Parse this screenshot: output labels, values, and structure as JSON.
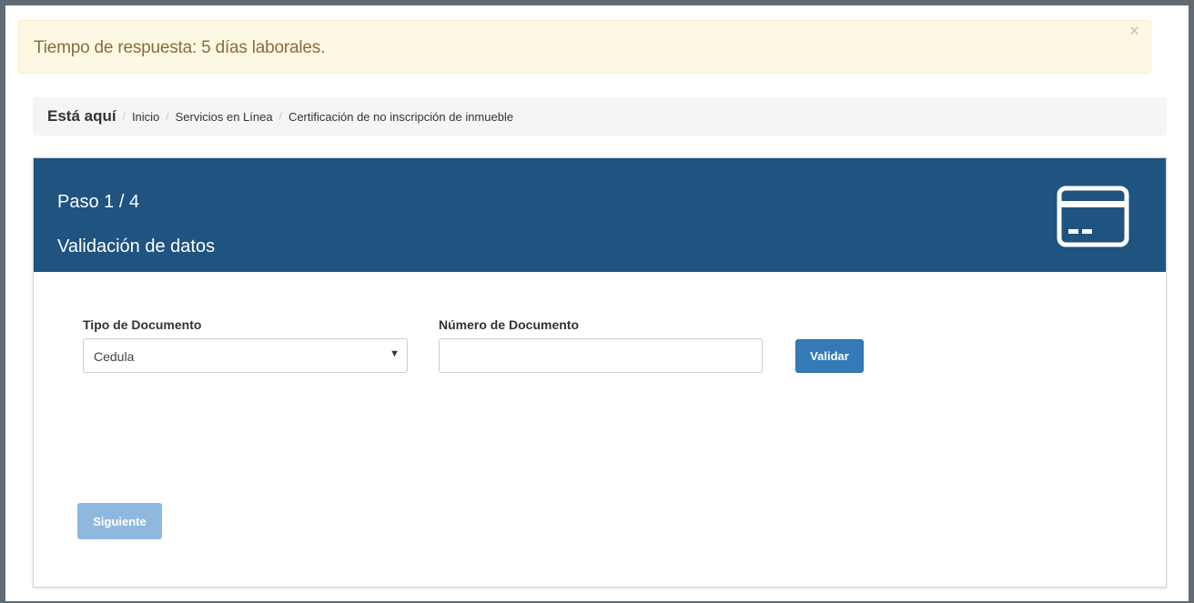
{
  "alert": {
    "message": "Tiempo de respuesta: 5 días laborales.",
    "close_label": "×"
  },
  "breadcrumb": {
    "heading": "Está aquí",
    "separator": "/",
    "items": [
      "Inicio",
      "Servicios en Línea",
      "Certificación de no inscripción de inmueble"
    ]
  },
  "panel": {
    "step": "Paso 1 / 4",
    "title": "Validación de datos",
    "icon": "credit-card-icon",
    "header_color": "#1f5380"
  },
  "form": {
    "document_type": {
      "label": "Tipo de Documento",
      "value": "Cedula"
    },
    "document_number": {
      "label": "Número de Documento",
      "value": "",
      "placeholder": ""
    },
    "validate_label": "Validar",
    "next_label": "Siguiente"
  },
  "colors": {
    "primary": "#337ab7",
    "primary_disabled": "#8fb8de",
    "alert_bg": "#fcf8e3",
    "alert_text": "#8a6d3b"
  }
}
